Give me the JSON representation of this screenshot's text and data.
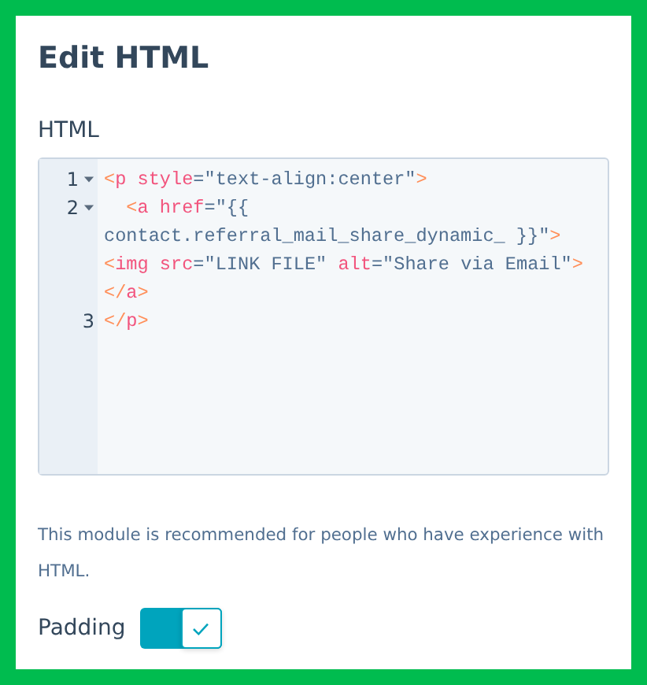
{
  "dialog": {
    "title": "Edit HTML"
  },
  "editor": {
    "label": "HTML",
    "lines": [
      {
        "number": "1",
        "foldable": true,
        "rows": [
          {
            "tokens": [
              {
                "kind": "punct",
                "text": "<"
              },
              {
                "kind": "tag",
                "text": "p "
              },
              {
                "kind": "attr",
                "text": "style"
              },
              {
                "kind": "plain",
                "text": "=\"text-align:center\""
              },
              {
                "kind": "punct",
                "text": ">"
              }
            ]
          }
        ]
      },
      {
        "number": "2",
        "foldable": true,
        "rows": [
          {
            "tokens": [
              {
                "kind": "punct",
                "text": "  <"
              },
              {
                "kind": "tag",
                "text": "a "
              },
              {
                "kind": "attr",
                "text": "href"
              },
              {
                "kind": "plain",
                "text": "=\"{{"
              }
            ]
          },
          {
            "tokens": [
              {
                "kind": "plain",
                "text": "contact.referral_mail_share_dynamic_ }}\""
              },
              {
                "kind": "punct",
                "text": ">"
              }
            ]
          },
          {
            "tokens": [
              {
                "kind": "punct",
                "text": "<"
              },
              {
                "kind": "tag",
                "text": "img "
              },
              {
                "kind": "attr",
                "text": "src"
              },
              {
                "kind": "plain",
                "text": "=\"LINK FILE\" "
              },
              {
                "kind": "attr",
                "text": "alt"
              },
              {
                "kind": "plain",
                "text": "=\"Share via Email\""
              },
              {
                "kind": "punct",
                "text": ">"
              }
            ]
          },
          {
            "tokens": [
              {
                "kind": "punct",
                "text": "</"
              },
              {
                "kind": "tag",
                "text": "a"
              },
              {
                "kind": "punct",
                "text": ">"
              }
            ]
          }
        ]
      },
      {
        "number": "3",
        "foldable": false,
        "rows": [
          {
            "tokens": [
              {
                "kind": "punct",
                "text": "</"
              },
              {
                "kind": "tag",
                "text": "p"
              },
              {
                "kind": "punct",
                "text": ">"
              }
            ]
          }
        ]
      }
    ]
  },
  "description": "This module is recommended for people who have experience with HTML.",
  "padding": {
    "label": "Padding",
    "on": true
  }
}
